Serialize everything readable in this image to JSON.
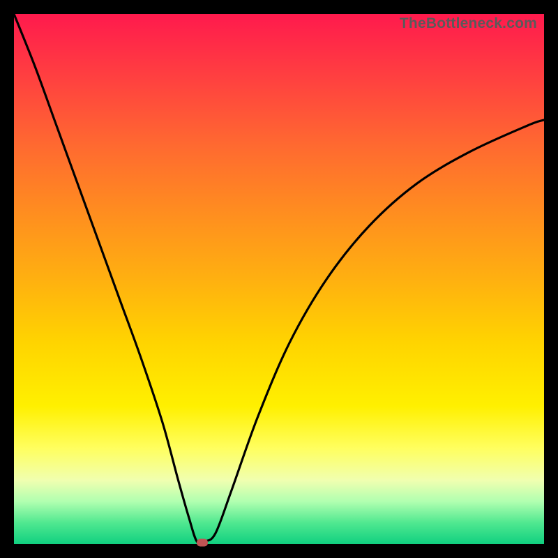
{
  "attribution": "TheBottleneck.com",
  "colors": {
    "top": "#ff1a4d",
    "mid": "#ffd400",
    "bottom": "#10d080",
    "curve": "#000000",
    "marker": "#c05454",
    "frame": "#000000"
  },
  "chart_data": {
    "type": "line",
    "title": "",
    "xlabel": "",
    "ylabel": "",
    "xlim": [
      0,
      1
    ],
    "ylim": [
      0,
      1
    ],
    "grid": false,
    "legend": false,
    "series": [
      {
        "name": "bottleneck-curve",
        "x": [
          0.0,
          0.04,
          0.08,
          0.12,
          0.16,
          0.2,
          0.24,
          0.28,
          0.31,
          0.33,
          0.345,
          0.36,
          0.38,
          0.41,
          0.46,
          0.52,
          0.59,
          0.67,
          0.76,
          0.86,
          0.97,
          1.0
        ],
        "y": [
          1.0,
          0.9,
          0.79,
          0.68,
          0.57,
          0.46,
          0.35,
          0.23,
          0.12,
          0.05,
          0.005,
          0.005,
          0.02,
          0.1,
          0.24,
          0.38,
          0.5,
          0.6,
          0.68,
          0.74,
          0.79,
          0.8
        ]
      }
    ],
    "annotations": [
      {
        "name": "min-marker",
        "x": 0.355,
        "y": 0.003
      }
    ]
  }
}
